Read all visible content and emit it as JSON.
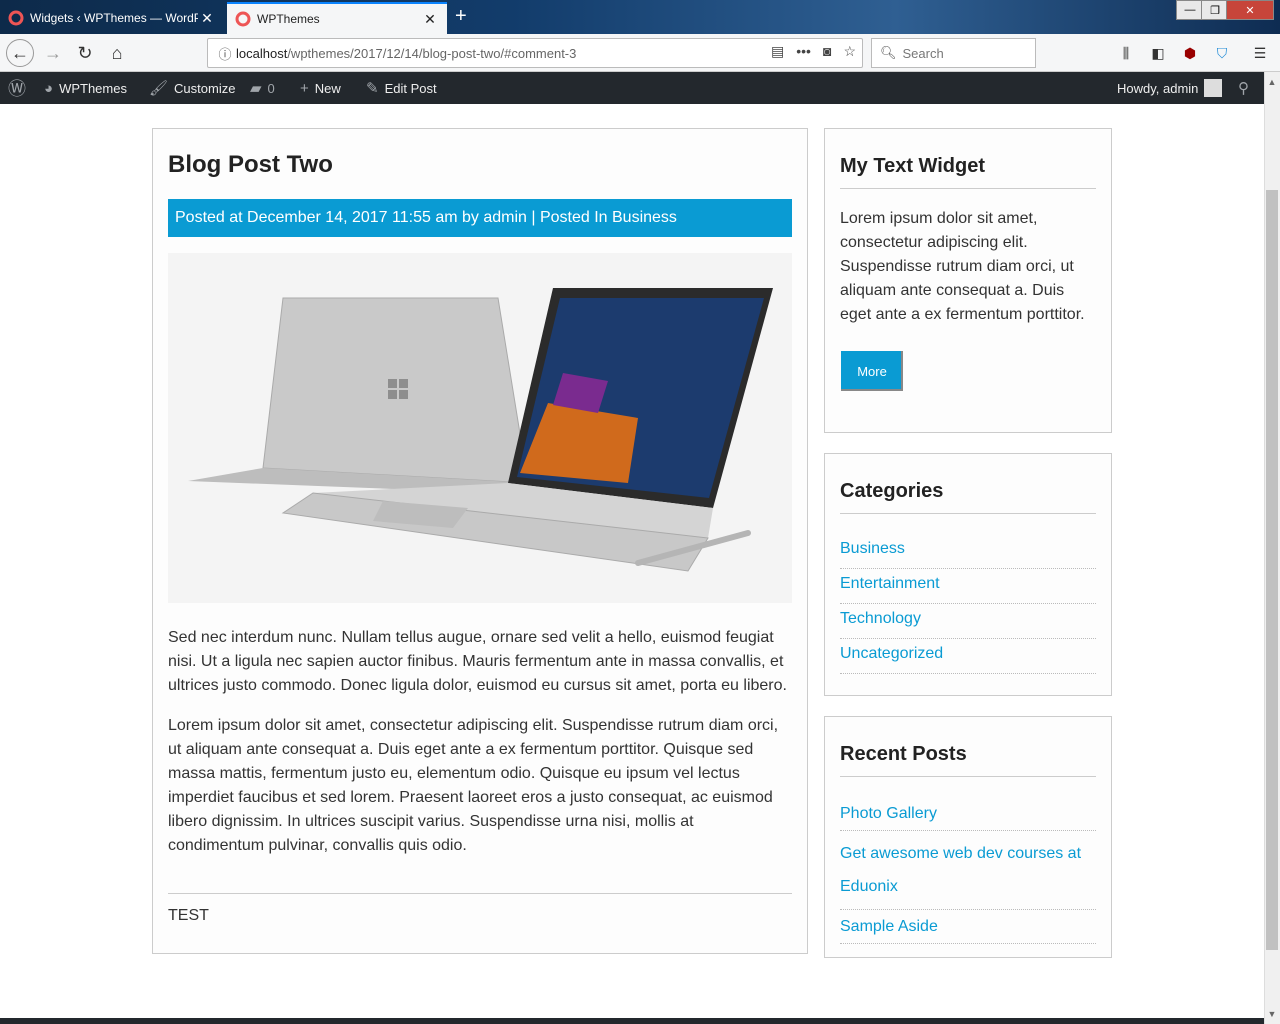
{
  "browser": {
    "tabs": [
      {
        "title": "Widgets ‹ WPThemes — WordPress",
        "active": false
      },
      {
        "title": "WPThemes",
        "active": true
      }
    ],
    "url_host": "localhost",
    "url_path": "/wpthemes/2017/12/14/blog-post-two/#comment-3",
    "search_placeholder": "Search",
    "window_controls": {
      "minimize": "—",
      "maximize": "❐",
      "close": "✕"
    }
  },
  "admin_bar": {
    "site_name": "WPThemes",
    "customize": "Customize",
    "comments_count": "0",
    "new_label": "New",
    "edit_post": "Edit Post",
    "howdy": "Howdy, admin"
  },
  "post": {
    "title": "Blog Post Two",
    "meta": "Posted at December 14, 2017 11:55 am by admin | Posted In Business",
    "paragraph1": "Sed nec interdum nunc. Nullam tellus augue, ornare sed velit a hello, euismod feugiat nisi. Ut a ligula nec sapien auctor finibus. Mauris fermentum ante in massa convallis, et ultrices justo commodo. Donec ligula dolor, euismod eu cursus sit amet, porta eu libero.",
    "paragraph2": "Lorem ipsum dolor sit amet, consectetur adipiscing elit. Suspendisse rutrum diam orci, ut aliquam ante consequat a. Duis eget ante a ex fermentum porttitor. Quisque sed massa mattis, fermentum justo eu, elementum odio. Quisque eu ipsum vel lectus imperdiet faucibus et sed lorem. Praesent laoreet eros a justo consequat, ac euismod libero dignissim. In ultrices suscipit varius. Suspendisse urna nisi, mollis at condimentum pulvinar, convallis quis odio.",
    "footer_text": "TEST"
  },
  "sidebar": {
    "text_widget": {
      "title": "My Text Widget",
      "body": "Lorem ipsum dolor sit amet, consectetur adipiscing elit. Suspendisse rutrum diam orci, ut aliquam ante consequat a. Duis eget ante a ex fermentum porttitor.",
      "button": "More"
    },
    "categories": {
      "title": "Categories",
      "items": [
        "Business",
        "Entertainment",
        "Technology",
        "Uncategorized"
      ]
    },
    "recent_posts": {
      "title": "Recent Posts",
      "items": [
        "Photo Gallery",
        "Get awesome web dev courses at Eduonix",
        "Sample Aside"
      ]
    }
  },
  "colors": {
    "accent": "#0a9bd3",
    "admin_bar": "#23282d"
  }
}
